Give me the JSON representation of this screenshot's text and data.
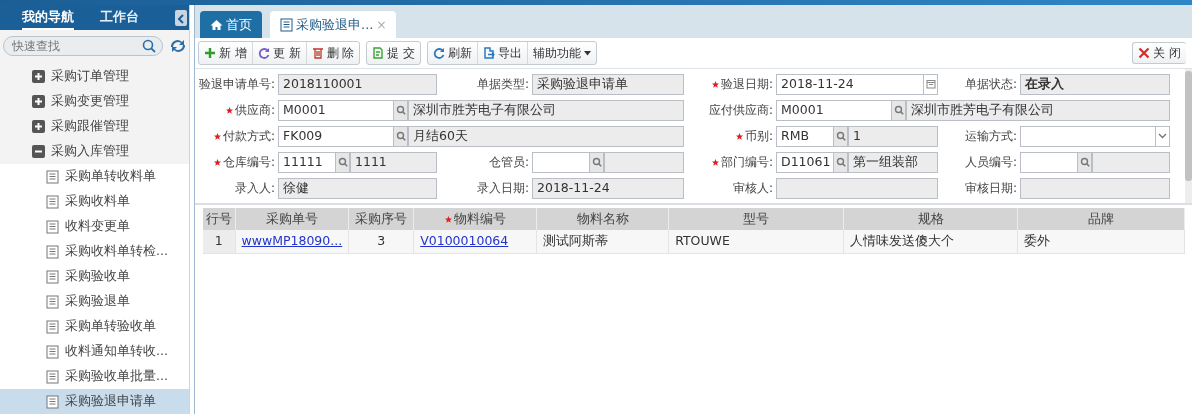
{
  "sidebar": {
    "tabs": [
      {
        "label": "我的导航",
        "selected": true
      },
      {
        "label": "工作台",
        "selected": false
      }
    ],
    "search": {
      "placeholder": "快速查找"
    },
    "tree": [
      {
        "label": "采购订单管理",
        "expanded": false
      },
      {
        "label": "采购变更管理",
        "expanded": false
      },
      {
        "label": "采购跟催管理",
        "expanded": false
      },
      {
        "label": "采购入库管理",
        "expanded": true,
        "children": [
          {
            "label": "采购单转收料单",
            "selected": false
          },
          {
            "label": "采购收料单",
            "selected": false
          },
          {
            "label": "收料变更单",
            "selected": false
          },
          {
            "label": "采购收料单转检...",
            "selected": false
          },
          {
            "label": "采购验收单",
            "selected": false
          },
          {
            "label": "采购验退单",
            "selected": false
          },
          {
            "label": "采购单转验收单",
            "selected": false
          },
          {
            "label": "收料通知单转收...",
            "selected": false
          },
          {
            "label": "采购验收单批量...",
            "selected": false
          },
          {
            "label": "采购验退申请单",
            "selected": true
          }
        ]
      }
    ]
  },
  "tabs": [
    {
      "label": "首页",
      "kind": "home",
      "selected": false
    },
    {
      "label": "采购验退申...",
      "kind": "document",
      "selected": true,
      "close": "×"
    }
  ],
  "toolbar": {
    "groups": [
      [
        {
          "label": "新 增",
          "kind": "add"
        },
        {
          "label": "更 新",
          "kind": "update"
        },
        {
          "label": "删 除",
          "kind": "delete"
        }
      ],
      [
        {
          "label": "提 交",
          "kind": "submit"
        }
      ],
      [
        {
          "label": "刷新",
          "kind": "refresh"
        },
        {
          "label": "导出",
          "kind": "export"
        },
        {
          "label": "辅助功能",
          "kind": "menu"
        }
      ]
    ],
    "close": {
      "label": "关 闭"
    }
  },
  "form": {
    "rows": [
      [
        {
          "label": "验退申请单号:",
          "kind": "text",
          "value": "2018110001",
          "readonly": true
        },
        {
          "label": "单据类型:",
          "kind": "text",
          "value": "采购验退申请单",
          "readonly": true
        },
        {
          "label": "验退日期:",
          "required": true,
          "kind": "date",
          "value": "2018-11-24"
        },
        {
          "label": "单据状态:",
          "kind": "text",
          "value": "在录入",
          "readonly": true,
          "strong": true
        }
      ],
      [
        {
          "label": "供应商:",
          "required": true,
          "kind": "lookup_wide",
          "colspan": 2,
          "value": "M0001",
          "name": "深圳市胜芳电子有限公司"
        },
        {
          "label": "应付供应商:",
          "kind": "lookup_wide",
          "colspan": 2,
          "value": "M0001",
          "name": "深圳市胜芳电子有限公司"
        }
      ],
      [
        {
          "label": "付款方式:",
          "required": true,
          "kind": "lookup_wide",
          "colspan": 2,
          "value": "FK009",
          "name": "月结60天"
        },
        {
          "label": "币别:",
          "required": true,
          "kind": "lookup",
          "value": "RMB",
          "name": "1"
        },
        {
          "label": "运输方式:",
          "kind": "select"
        }
      ],
      [
        {
          "label": "仓库编号:",
          "required": true,
          "kind": "lookup",
          "value": "11111",
          "name": "1111"
        },
        {
          "label": "仓管员:",
          "kind": "lookup"
        },
        {
          "label": "部门编号:",
          "required": true,
          "kind": "lookup",
          "value": "D11061",
          "name": "第一组装部"
        },
        {
          "label": "人员编号:",
          "kind": "lookup"
        }
      ],
      [
        {
          "label": "录入人:",
          "kind": "text",
          "value": "徐健",
          "readonly": true
        },
        {
          "label": "录入日期:",
          "kind": "text",
          "value": "2018-11-24",
          "readonly": true
        },
        {
          "label": "审核人:",
          "kind": "text",
          "readonly": true
        },
        {
          "label": "审核日期:",
          "kind": "text",
          "readonly": true
        }
      ]
    ]
  },
  "grid": {
    "columns": [
      {
        "label": "行号",
        "numeric": true
      },
      {
        "label": "采购单号"
      },
      {
        "label": "采购序号",
        "numeric": true
      },
      {
        "label": "物料编号",
        "required": true
      },
      {
        "label": "物料名称"
      },
      {
        "label": "型号"
      },
      {
        "label": "规格"
      },
      {
        "label": "品牌"
      }
    ],
    "rows": [
      {
        "cells": [
          {
            "text": "1"
          },
          {
            "text": "wwwMP18090...",
            "link": true
          },
          {
            "text": "3"
          },
          {
            "text": "V0100010064",
            "link": true
          },
          {
            "text": "测试阿斯蒂"
          },
          {
            "text": "RTOUWE"
          },
          {
            "text": "人情味发送傻大个"
          },
          {
            "text": "委外"
          }
        ]
      }
    ]
  }
}
